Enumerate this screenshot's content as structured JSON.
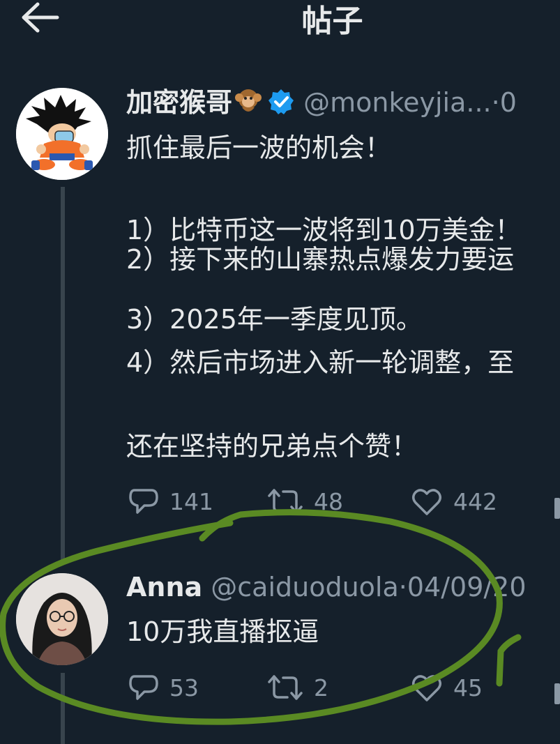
{
  "header": {
    "title": "帖子",
    "back_icon": "arrow-left-icon"
  },
  "colors": {
    "background": "#15202b",
    "text": "#e7e9ea",
    "muted": "#8b98a5",
    "verified": "#1d9bf0",
    "annotation": "#5a8a23"
  },
  "original_post": {
    "name": "加密猴哥",
    "name_emoji": "🐒",
    "handle": "@monkeyjia...",
    "separator": "·",
    "date_fragment": "0",
    "lines": [
      "抓住最后一波的机会！",
      "",
      "1）比特币这一波将到10万美金！",
      "2）接下来的山寨热点爆发力要运",
      "3）2025年一季度见顶。",
      "4）然后市场进入新一轮调整，至",
      "",
      "还在坚持的兄弟点个赞！"
    ],
    "replies": "141",
    "retweets": "48",
    "likes": "442"
  },
  "reply_post": {
    "name": "Anna",
    "handle": "@caiduoduola",
    "separator": "·",
    "date": "04/09/20",
    "text": "10万我直播抠逼",
    "replies": "53",
    "retweets": "2",
    "likes": "45"
  }
}
